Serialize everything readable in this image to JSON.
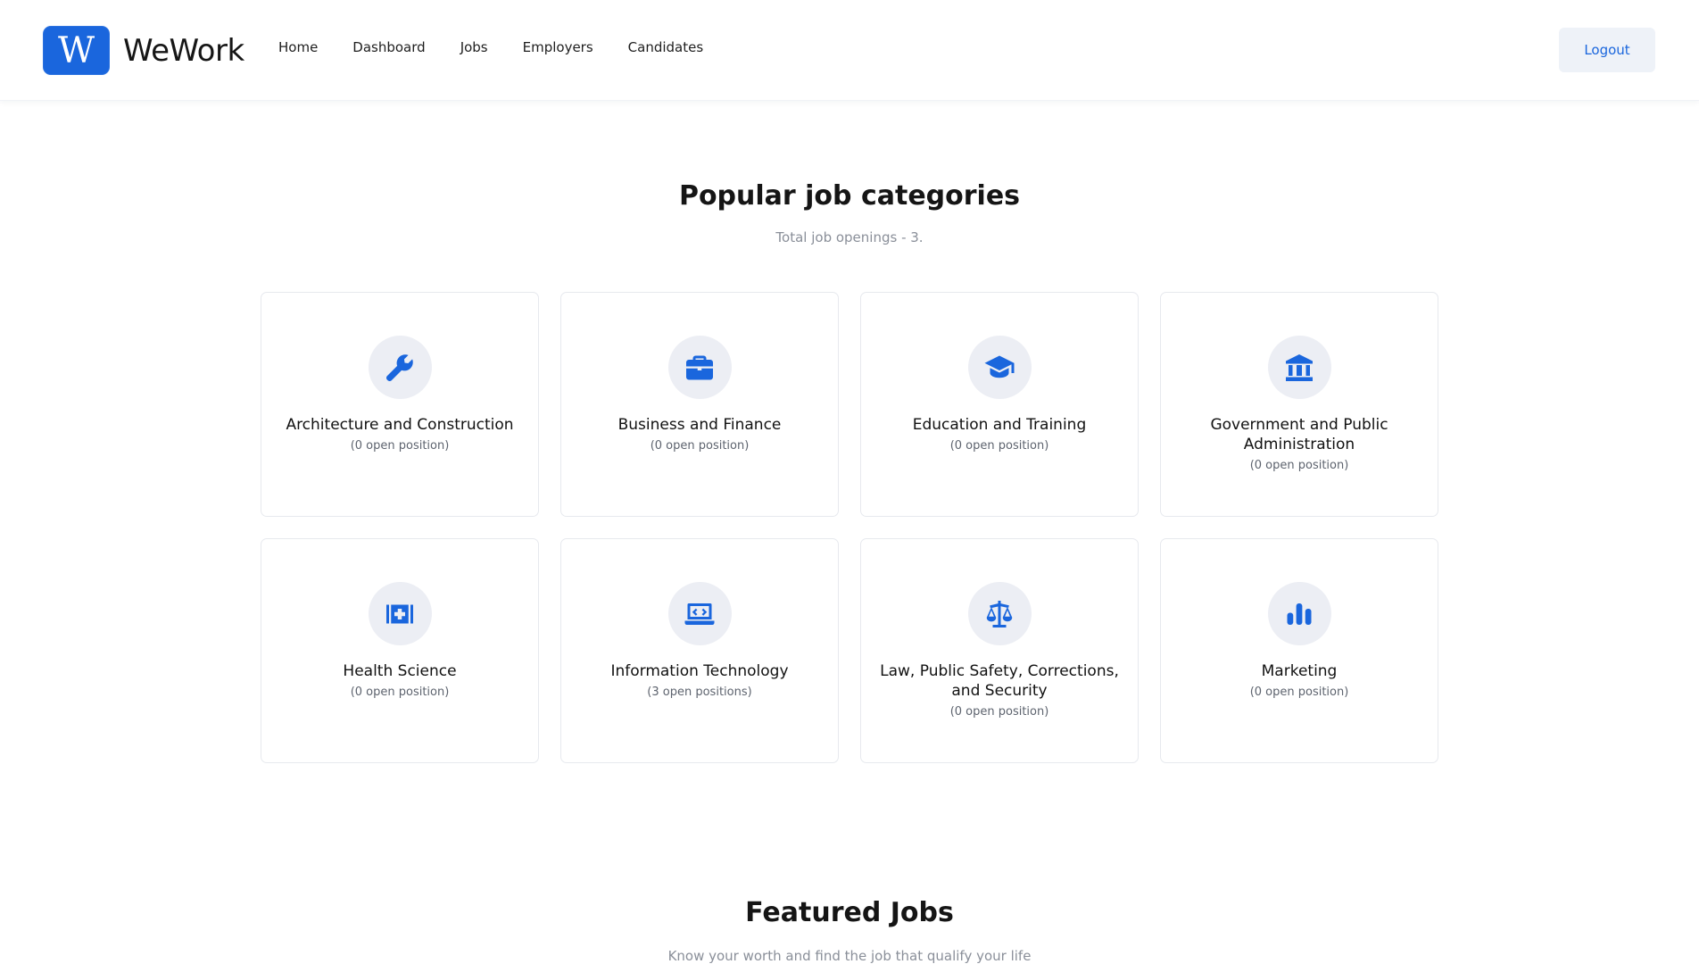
{
  "brand": {
    "logo_letter": "W",
    "name": "WeWork",
    "accent": "#1a66dd"
  },
  "nav": {
    "items": [
      {
        "label": "Home"
      },
      {
        "label": "Dashboard"
      },
      {
        "label": "Jobs"
      },
      {
        "label": "Employers"
      },
      {
        "label": "Candidates"
      }
    ]
  },
  "header": {
    "logout_label": "Logout"
  },
  "categories_section": {
    "title": "Popular job categories",
    "subtitle": "Total job openings - 3.",
    "items": [
      {
        "title": "Architecture and Construction",
        "count": "(0 open position)",
        "icon": "wrench-icon"
      },
      {
        "title": "Business and Finance",
        "count": "(0 open position)",
        "icon": "briefcase-icon"
      },
      {
        "title": "Education and Training",
        "count": "(0 open position)",
        "icon": "graduation-cap-icon"
      },
      {
        "title": "Government and Public Administration",
        "count": "(0 open position)",
        "icon": "government-building-icon"
      },
      {
        "title": "Health Science",
        "count": "(0 open position)",
        "icon": "medical-kit-icon"
      },
      {
        "title": "Information Technology",
        "count": "(3 open positions)",
        "icon": "laptop-code-icon"
      },
      {
        "title": "Law, Public Safety, Corrections, and Security",
        "count": "(0 open position)",
        "icon": "scales-icon"
      },
      {
        "title": "Marketing",
        "count": "(0 open position)",
        "icon": "bar-chart-icon"
      }
    ]
  },
  "featured_section": {
    "title": "Featured Jobs",
    "subtitle": "Know your worth and find the job that qualify your life"
  }
}
